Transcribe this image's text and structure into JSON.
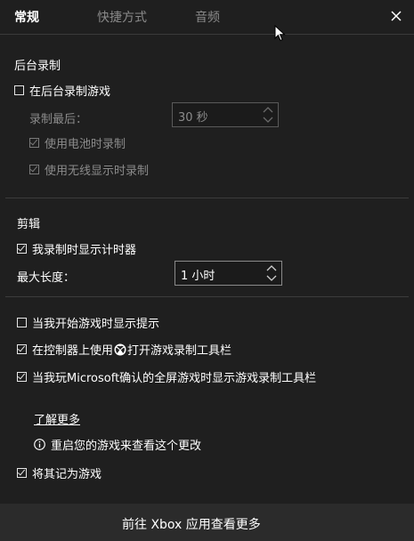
{
  "tabs": [
    {
      "label": "常规"
    },
    {
      "label": "快捷方式"
    },
    {
      "label": "音频"
    }
  ],
  "background_recording": {
    "title": "后台录制",
    "record_in_background": {
      "label": "在后台录制游戏",
      "checked": false
    },
    "record_last": {
      "label": "录制最后：",
      "value": "30 秒"
    },
    "record_on_battery": {
      "label": "使用电池时录制",
      "checked": true
    },
    "record_wireless_display": {
      "label": "使用无线显示时录制",
      "checked": true
    }
  },
  "clips": {
    "title": "剪辑",
    "show_timer": {
      "label": "我录制时显示计时器",
      "checked": true
    },
    "max_length": {
      "label": "最大长度：",
      "value": "1 小时"
    }
  },
  "tips": {
    "show_tips_on_start": {
      "label": "当我开始游戏时显示提示",
      "checked": false
    },
    "open_with_controller": {
      "label_before": "在控制器上使用",
      "label_after": "打开游戏录制工具栏",
      "checked": true
    },
    "fullscreen_toolbar": {
      "label": "当我玩Microsoft确认的全屏游戏时显示游戏录制工具栏",
      "checked": true
    }
  },
  "learn_more": "了解更多",
  "restart_notice": "重启您的游戏来查看这个更改",
  "remember_as_game": {
    "label": "将其记为游戏",
    "checked": true
  },
  "footer": {
    "label": "前往 Xbox 应用查看更多"
  },
  "colors": {
    "background": "#1f1f1f",
    "footer": "#2b2b2b",
    "disabled_text": "#8b8b8b"
  }
}
